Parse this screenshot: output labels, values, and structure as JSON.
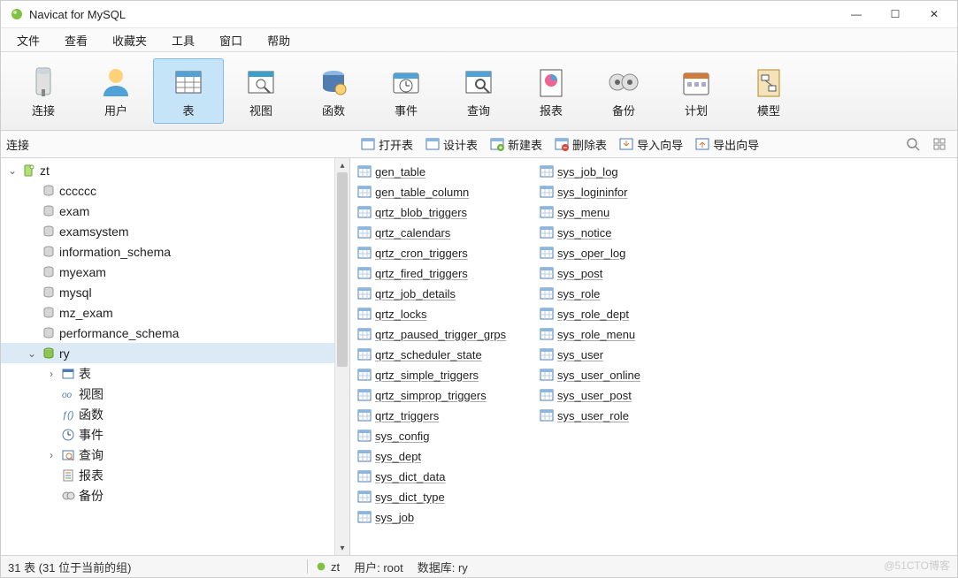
{
  "window": {
    "title": "Navicat for MySQL"
  },
  "menu": {
    "items": [
      "文件",
      "查看",
      "收藏夹",
      "工具",
      "窗口",
      "帮助"
    ]
  },
  "toolbar": {
    "items": [
      {
        "label": "连接",
        "icon": "connection-icon",
        "selected": false
      },
      {
        "label": "用户",
        "icon": "user-icon",
        "selected": false
      },
      {
        "label": "表",
        "icon": "table-icon",
        "selected": true
      },
      {
        "label": "视图",
        "icon": "view-icon",
        "selected": false
      },
      {
        "label": "函数",
        "icon": "function-icon",
        "selected": false
      },
      {
        "label": "事件",
        "icon": "event-icon",
        "selected": false
      },
      {
        "label": "查询",
        "icon": "query-icon",
        "selected": false
      },
      {
        "label": "报表",
        "icon": "report-icon",
        "selected": false
      },
      {
        "label": "备份",
        "icon": "backup-icon",
        "selected": false
      },
      {
        "label": "计划",
        "icon": "schedule-icon",
        "selected": false
      },
      {
        "label": "模型",
        "icon": "model-icon",
        "selected": false
      }
    ]
  },
  "subbar": {
    "left_label": "连接",
    "actions": [
      {
        "label": "打开表",
        "name": "open-table"
      },
      {
        "label": "设计表",
        "name": "design-table"
      },
      {
        "label": "新建表",
        "name": "new-table"
      },
      {
        "label": "删除表",
        "name": "delete-table"
      },
      {
        "label": "导入向导",
        "name": "import-wizard"
      },
      {
        "label": "导出向导",
        "name": "export-wizard"
      }
    ]
  },
  "tree": [
    {
      "depth": 0,
      "twisty": "open",
      "icon": "server-icon",
      "label": "zt",
      "selected": false,
      "interactable": true
    },
    {
      "depth": 1,
      "twisty": "",
      "icon": "database-icon",
      "label": "cccccc",
      "selected": false,
      "interactable": true
    },
    {
      "depth": 1,
      "twisty": "",
      "icon": "database-icon",
      "label": "exam",
      "selected": false,
      "interactable": true
    },
    {
      "depth": 1,
      "twisty": "",
      "icon": "database-icon",
      "label": "examsystem",
      "selected": false,
      "interactable": true
    },
    {
      "depth": 1,
      "twisty": "",
      "icon": "database-icon",
      "label": "information_schema",
      "selected": false,
      "interactable": true
    },
    {
      "depth": 1,
      "twisty": "",
      "icon": "database-icon",
      "label": "myexam",
      "selected": false,
      "interactable": true
    },
    {
      "depth": 1,
      "twisty": "",
      "icon": "database-icon",
      "label": "mysql",
      "selected": false,
      "interactable": true
    },
    {
      "depth": 1,
      "twisty": "",
      "icon": "database-icon",
      "label": "mz_exam",
      "selected": false,
      "interactable": true
    },
    {
      "depth": 1,
      "twisty": "",
      "icon": "database-icon",
      "label": "performance_schema",
      "selected": false,
      "interactable": true
    },
    {
      "depth": 1,
      "twisty": "open",
      "icon": "database-open-icon",
      "label": "ry",
      "selected": true,
      "interactable": true
    },
    {
      "depth": 2,
      "twisty": "closed",
      "icon": "tables-icon",
      "label": "表",
      "selected": false,
      "interactable": true
    },
    {
      "depth": 2,
      "twisty": "",
      "icon": "views-icon",
      "label": "视图",
      "selected": false,
      "interactable": true
    },
    {
      "depth": 2,
      "twisty": "",
      "icon": "functions-icon",
      "label": "函数",
      "selected": false,
      "interactable": true
    },
    {
      "depth": 2,
      "twisty": "",
      "icon": "events-icon",
      "label": "事件",
      "selected": false,
      "interactable": true
    },
    {
      "depth": 2,
      "twisty": "closed",
      "icon": "queries-icon",
      "label": "查询",
      "selected": false,
      "interactable": true
    },
    {
      "depth": 2,
      "twisty": "",
      "icon": "reports-icon",
      "label": "报表",
      "selected": false,
      "interactable": true
    },
    {
      "depth": 2,
      "twisty": "",
      "icon": "backups-icon",
      "label": "备份",
      "selected": false,
      "interactable": true
    }
  ],
  "tables": {
    "col1": [
      "gen_table",
      "gen_table_column",
      "qrtz_blob_triggers",
      "qrtz_calendars",
      "qrtz_cron_triggers",
      "qrtz_fired_triggers",
      "qrtz_job_details",
      "qrtz_locks",
      "qrtz_paused_trigger_grps",
      "qrtz_scheduler_state",
      "qrtz_simple_triggers",
      "qrtz_simprop_triggers",
      "qrtz_triggers",
      "sys_config",
      "sys_dept",
      "sys_dict_data",
      "sys_dict_type",
      "sys_job"
    ],
    "col2": [
      "sys_job_log",
      "sys_logininfor",
      "sys_menu",
      "sys_notice",
      "sys_oper_log",
      "sys_post",
      "sys_role",
      "sys_role_dept",
      "sys_role_menu",
      "sys_user",
      "sys_user_online",
      "sys_user_post",
      "sys_user_role"
    ]
  },
  "status": {
    "count": "31 表 (31 位于当前的组)",
    "server": "zt",
    "user_label": "用户: root",
    "db_label": "数据库: ry"
  },
  "watermark": "@51CTO博客"
}
